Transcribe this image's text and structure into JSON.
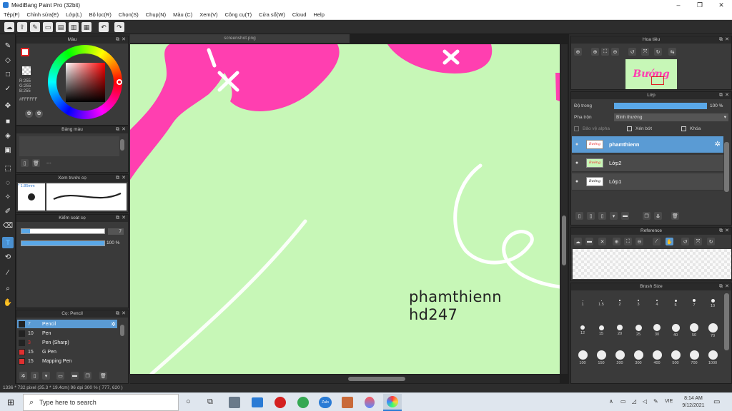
{
  "window": {
    "title": "MediBang Paint Pro (32bit)",
    "minimize": "–",
    "maximize": "❐",
    "close": "✕"
  },
  "menu": [
    "Tệp(F)",
    "Chỉnh sửa(E)",
    "Lớp(L)",
    "Bộ lọc(R)",
    "Chọn(S)",
    "Chụp(N)",
    "Màu (C)",
    "Xem(V)",
    "Công cụ(T)",
    "Cửa sổ(W)",
    "Cloud",
    "Help"
  ],
  "panels": {
    "color": {
      "title": "Màu",
      "r": "R:255",
      "g": "G:255",
      "b": "B:255",
      "hex": "#FFFFFF"
    },
    "palette": {
      "title": "Bảng màu",
      "dash": "---"
    },
    "brush_preview": {
      "title": "Xem trước cọ",
      "size": "* 1.85mm"
    },
    "brush_control": {
      "title": "Kiểm soát cọ",
      "size_value": "7",
      "opacity_value": "100 %",
      "size_fill": 0.1,
      "opacity_fill": 1.0
    },
    "brush_list": {
      "title": "Cọ: Pencil",
      "items": [
        {
          "size": "7",
          "name": "Pencil",
          "color": "#222222",
          "selected": true
        },
        {
          "size": "10",
          "name": "Pen",
          "color": "#222222",
          "selected": false
        },
        {
          "size": "3",
          "name": "Pen (Sharp)",
          "color": "#222222",
          "selected": false
        },
        {
          "size": "15",
          "name": "G Pen",
          "color": "#e03030",
          "selected": false
        },
        {
          "size": "15",
          "name": "Mapping Pen",
          "color": "#e03030",
          "selected": false
        }
      ]
    }
  },
  "document": {
    "tab": "screenshot.png"
  },
  "canvas": {
    "text_line1": "phamthienn",
    "text_line2": "hd247",
    "background": "#c7f7b7",
    "pink": "#ff3fb0"
  },
  "right": {
    "navigator": {
      "title": "Hoa tiêu",
      "thumb_text": "Bướng"
    },
    "layers": {
      "title": "Lớp",
      "opacity_label": "Độ trong",
      "opacity_value": "100 %",
      "blend_label": "Pha trộn",
      "blend_value": "Bình thường",
      "protect_alpha": "Bảo vệ alpha",
      "clip": "Xén bớt",
      "lock": "Khóa",
      "items": [
        {
          "name": "phamthienn",
          "selected": true,
          "thumb": "Bướng"
        },
        {
          "name": "Lớp2",
          "selected": false,
          "thumb": "Bướng"
        },
        {
          "name": "Lớp1",
          "selected": false,
          "thumb": "Bướng"
        }
      ]
    },
    "reference": {
      "title": "Reference"
    },
    "brush_size": {
      "title": "Brush Size",
      "labels": [
        "1",
        "1.5",
        "2",
        "3",
        "4",
        "5",
        "7",
        "10",
        "12",
        "15",
        "20",
        "25",
        "30",
        "40",
        "50",
        "70",
        "100",
        "150",
        "200",
        "300",
        "400",
        "500",
        "700",
        "1000"
      ]
    }
  },
  "status": "1336 * 732 pixel  (35.3 * 19.4cm)  96 dpi  300 %  ( 777, 620 )",
  "taskbar": {
    "search_placeholder": "Type here to search",
    "time": "8:14 AM",
    "date": "9/12/2021",
    "lang": "VIE"
  }
}
